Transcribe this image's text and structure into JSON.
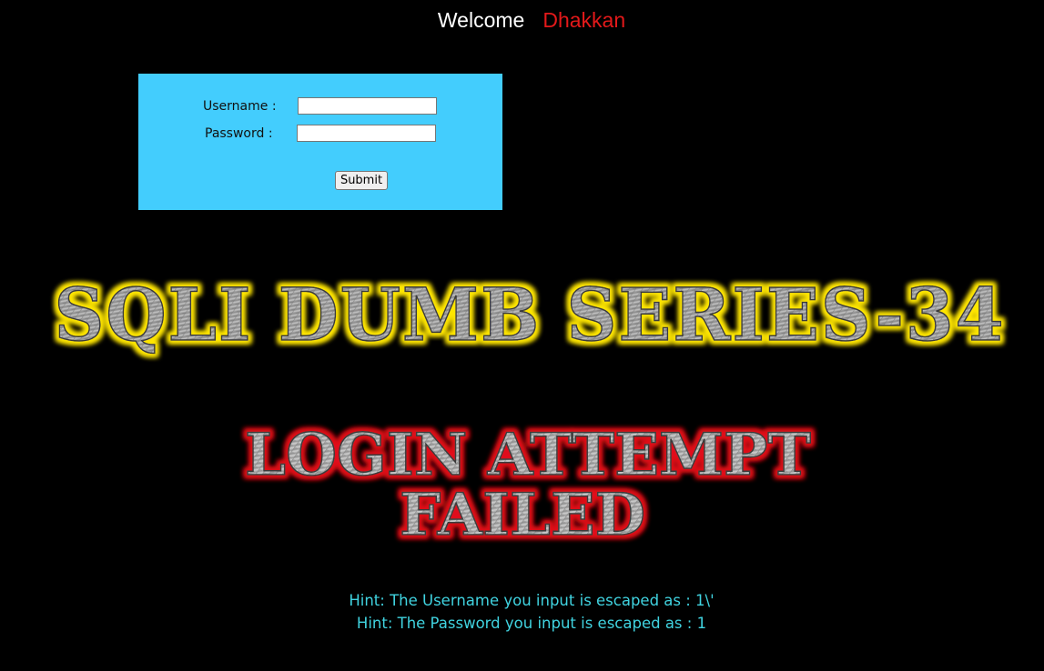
{
  "header": {
    "welcome": "Welcome",
    "name": "Dhakkan"
  },
  "login_form": {
    "username_label": "Username :",
    "password_label": "Password :",
    "username_value": "",
    "password_value": "",
    "submit_label": "Submit"
  },
  "title_image": {
    "text": "SQLI DUMB SERIES-34"
  },
  "result_image": {
    "line1": "LOGIN ATTEMPT",
    "line2": "FAILED"
  },
  "hints": {
    "username_hint": "Hint: The Username you input is escaped as : 1\\'",
    "password_hint": "Hint: The Password you input is escaped as : 1"
  },
  "colors": {
    "background": "#000000",
    "form_background": "#43cdfd",
    "welcome_name": "#e3191a",
    "hint_text": "#40d3e0",
    "title_glow": "#ffe600",
    "result_glow": "#e0101a",
    "metal_text": "#9a9a9a"
  }
}
